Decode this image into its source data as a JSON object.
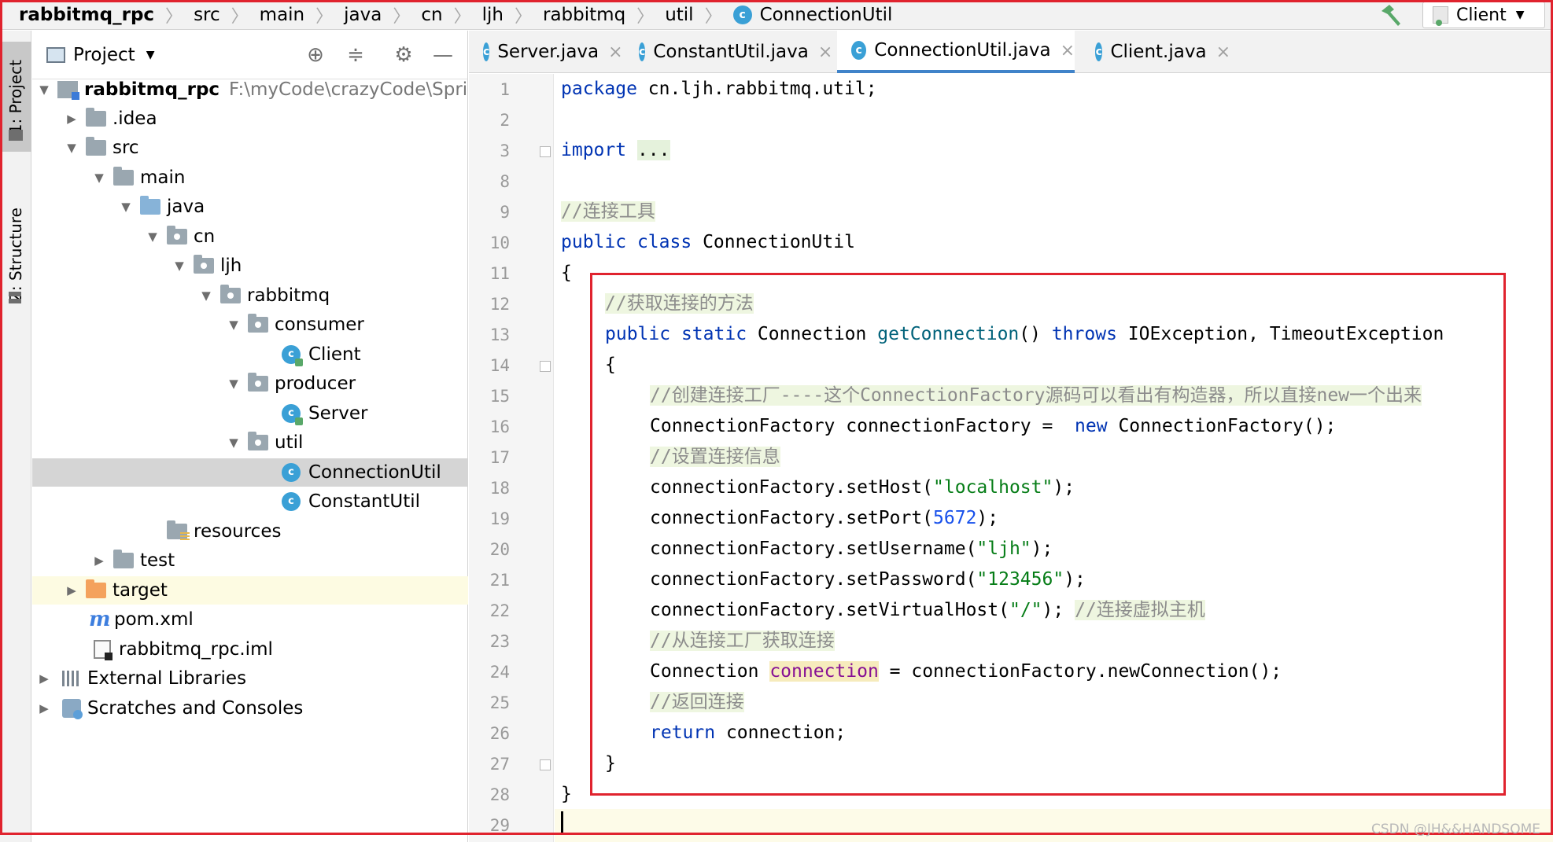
{
  "breadcrumb": {
    "items": [
      "rabbitmq_rpc",
      "src",
      "main",
      "java",
      "cn",
      "ljh",
      "rabbitmq",
      "util"
    ],
    "current_file": "ConnectionUtil"
  },
  "run_config": {
    "label": "Client"
  },
  "tool_strip": {
    "project_tab": "1: Project",
    "structure_tab": "Z: Structure"
  },
  "project_panel": {
    "title": "Project",
    "tree": [
      {
        "label": "rabbitmq_rpc",
        "path": "F:\\myCode\\crazyCode\\SpringB"
      },
      {
        "label": ".idea"
      },
      {
        "label": "src"
      },
      {
        "label": "main"
      },
      {
        "label": "java"
      },
      {
        "label": "cn"
      },
      {
        "label": "ljh"
      },
      {
        "label": "rabbitmq"
      },
      {
        "label": "consumer"
      },
      {
        "label": "Client"
      },
      {
        "label": "producer"
      },
      {
        "label": "Server"
      },
      {
        "label": "util"
      },
      {
        "label": "ConnectionUtil"
      },
      {
        "label": "ConstantUtil"
      },
      {
        "label": "resources"
      },
      {
        "label": "test"
      },
      {
        "label": "target"
      },
      {
        "label": "pom.xml"
      },
      {
        "label": "rabbitmq_rpc.iml"
      },
      {
        "label": "External Libraries"
      },
      {
        "label": "Scratches and Consoles"
      }
    ]
  },
  "editor_tabs": [
    {
      "label": "Server.java"
    },
    {
      "label": "ConstantUtil.java"
    },
    {
      "label": "ConnectionUtil.java",
      "active": true
    },
    {
      "label": "Client.java"
    }
  ],
  "line_numbers": [
    "1",
    "2",
    "3",
    "8",
    "9",
    "10",
    "11",
    "12",
    "13",
    "14",
    "15",
    "16",
    "17",
    "18",
    "19",
    "20",
    "21",
    "22",
    "23",
    "24",
    "25",
    "26",
    "27",
    "28",
    "29"
  ],
  "code": {
    "l1": {
      "kw": "package",
      "rest": " cn.ljh.rabbitmq.util;"
    },
    "l3": {
      "kw": "import",
      "folded": "..."
    },
    "l9": {
      "comment": "//连接工具"
    },
    "l10": {
      "kw1": "public",
      "kw2": "class",
      "rest": "ConnectionUtil"
    },
    "l11": {
      "brace": "{"
    },
    "l12": {
      "comment": "//获取连接的方法"
    },
    "l13": {
      "kw1": "public",
      "kw2": "static",
      "type": "Connection",
      "method": "getConnection",
      "parens": "()",
      "kw3": "throws",
      "rest": "IOException, TimeoutException"
    },
    "l14": {
      "brace": "{"
    },
    "l15": {
      "comment": "//创建连接工厂----这个ConnectionFactory源码可以看出有构造器，所以直接new一个出来"
    },
    "l16": {
      "lhs": "ConnectionFactory connectionFactory =  ",
      "kw": "new",
      "rest": " ConnectionFactory();"
    },
    "l17": {
      "comment": "//设置连接信息"
    },
    "l18": {
      "pre": "connectionFactory.setHost(",
      "str": "\"localhost\"",
      "post": ");"
    },
    "l19": {
      "pre": "connectionFactory.setPort(",
      "num": "5672",
      "post": ");"
    },
    "l20": {
      "pre": "connectionFactory.setUsername(",
      "str": "\"ljh\"",
      "post": ");"
    },
    "l21": {
      "pre": "connectionFactory.setPassword(",
      "str": "\"123456\"",
      "post": ");"
    },
    "l22": {
      "pre": "connectionFactory.setVirtualHost(",
      "str": "\"/\"",
      "post": "); ",
      "comment": "//连接虚拟主机"
    },
    "l23": {
      "comment": "//从连接工厂获取连接"
    },
    "l24": {
      "type": "Connection ",
      "var": "connection",
      "rest": " = connectionFactory.newConnection();"
    },
    "l25": {
      "comment": "//返回连接"
    },
    "l26": {
      "kw": "return",
      "rest": " connection;"
    },
    "l27": {
      "brace": "}"
    },
    "l28": {
      "brace": "}"
    }
  },
  "watermark": "CSDN @JH&&HANDSOME",
  "colors": {
    "accent": "#4083c9",
    "annotation_red": "#e0232e",
    "keyword": "#0033b3",
    "string": "#067d17",
    "comment": "#8c8c8c"
  }
}
